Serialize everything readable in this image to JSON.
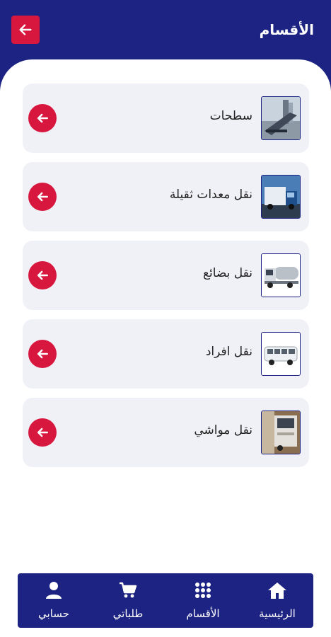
{
  "header": {
    "title": "الأقسام",
    "back_icon": "arrow-left-icon",
    "accent_color": "#d8173f",
    "brand_color": "#1c2383"
  },
  "categories": [
    {
      "label": "سطحات",
      "thumb": "flatbed-truck-photo"
    },
    {
      "label": "نقل معدات ثقيلة",
      "thumb": "heavy-truck-photo"
    },
    {
      "label": "نقل بضائع",
      "thumb": "cargo-tanker-photo"
    },
    {
      "label": "نقل افراد",
      "thumb": "bus-photo"
    },
    {
      "label": "نقل مواشي",
      "thumb": "livestock-truck-photo"
    }
  ],
  "nav": {
    "home": {
      "label": "الرئيسية",
      "icon": "home-icon"
    },
    "categories": {
      "label": "الأقسام",
      "icon": "grid-icon"
    },
    "orders": {
      "label": "طلباتي",
      "icon": "cart-icon"
    },
    "account": {
      "label": "حسابي",
      "icon": "user-icon"
    }
  }
}
